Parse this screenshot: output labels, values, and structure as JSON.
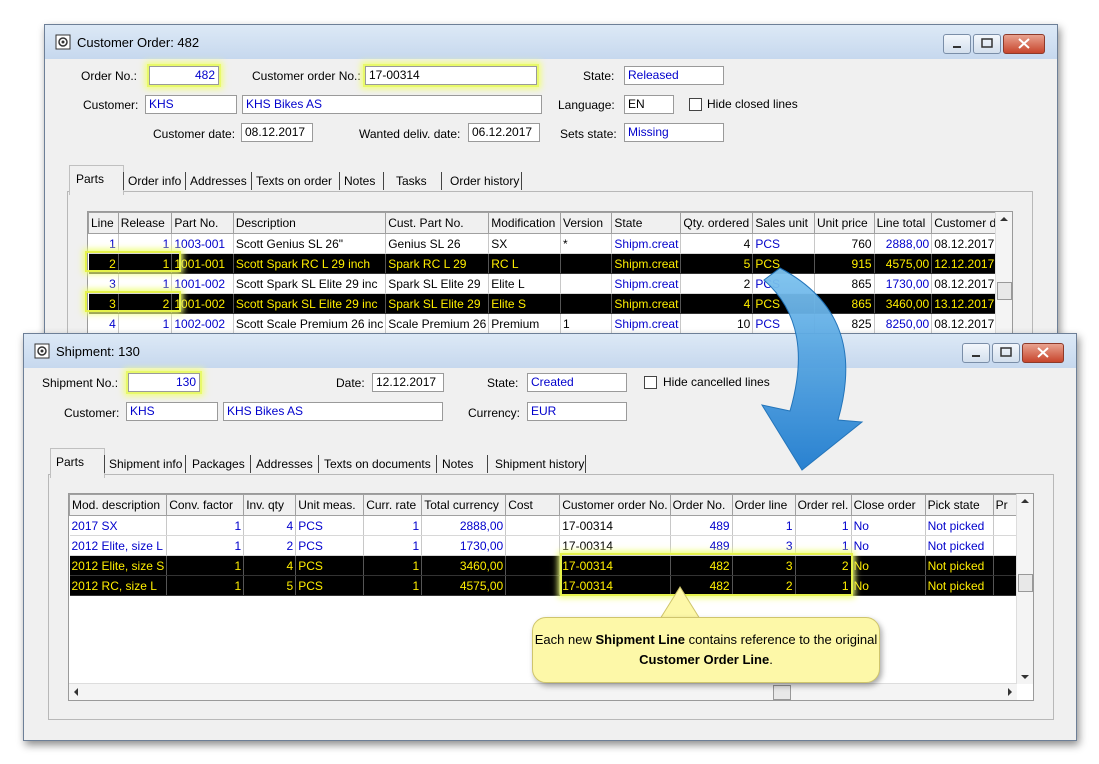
{
  "order_window": {
    "title": "Customer Order: 482",
    "order_no_label": "Order No.:",
    "order_no": "482",
    "customer_order_no_label": "Customer order No.:",
    "customer_order_no": "17-00314",
    "state_label": "State:",
    "state": "Released",
    "customer_label": "Customer:",
    "customer_code": "KHS",
    "customer_name": "KHS Bikes AS",
    "language_label": "Language:",
    "language": "EN",
    "hide_closed_label": "Hide closed lines",
    "customer_date_label": "Customer date:",
    "customer_date": "08.12.2017",
    "wanted_date_label": "Wanted deliv. date:",
    "wanted_date": "06.12.2017",
    "sets_state_label": "Sets state:",
    "sets_state": "Missing",
    "tabs": [
      "Parts",
      "Order info",
      "Addresses",
      "Texts on order",
      "Notes",
      "Tasks",
      "Order history"
    ],
    "columns": [
      "Line",
      "Release",
      "Part No.",
      "Description",
      "Cust. Part No.",
      "Modification",
      "Version",
      "State",
      "Qty. ordered",
      "Sales unit",
      "Unit price",
      "Line total",
      "Customer dat"
    ],
    "rows": [
      {
        "line": "1",
        "release": "1",
        "part": "1003-001",
        "desc": "Scott Genius SL 26\"",
        "cust_part": "Genius SL 26",
        "mod": "SX",
        "version": "*",
        "state": "Shipm.creat",
        "qty": "4",
        "unit": "PCS",
        "price": "760",
        "total": "2888,00",
        "date": "08.12.2017"
      },
      {
        "line": "2",
        "release": "1",
        "part": "1001-001",
        "desc": "Scott Spark RC L 29 inch",
        "cust_part": "Spark RC L 29",
        "mod": "RC L",
        "version": "",
        "state": "Shipm.creat",
        "qty": "5",
        "unit": "PCS",
        "price": "915",
        "total": "4575,00",
        "date": "12.12.2017"
      },
      {
        "line": "3",
        "release": "1",
        "part": "1001-002",
        "desc": "Scott Spark SL Elite 29 inc",
        "cust_part": "Spark SL Elite 29",
        "mod": "Elite L",
        "version": "",
        "state": "Shipm.creat",
        "qty": "2",
        "unit": "PCS",
        "price": "865",
        "total": "1730,00",
        "date": "08.12.2017"
      },
      {
        "line": "3",
        "release": "2",
        "part": "1001-002",
        "desc": "Scott Spark SL Elite 29 inc",
        "cust_part": "Spark SL Elite 29",
        "mod": "Elite S",
        "version": "",
        "state": "Shipm.creat",
        "qty": "4",
        "unit": "PCS",
        "price": "865",
        "total": "3460,00",
        "date": "13.12.2017"
      },
      {
        "line": "4",
        "release": "1",
        "part": "1002-002",
        "desc": "Scott Scale Premium 26 inc",
        "cust_part": "Scale Premium 26",
        "mod": "Premium",
        "version": "1",
        "state": "Shipm.creat",
        "qty": "10",
        "unit": "PCS",
        "price": "825",
        "total": "8250,00",
        "date": "08.12.2017"
      }
    ]
  },
  "shipment_window": {
    "title": "Shipment: 130",
    "shipment_no_label": "Shipment No.:",
    "shipment_no": "130",
    "date_label": "Date:",
    "date": "12.12.2017",
    "state_label": "State:",
    "state": "Created",
    "hide_cancelled_label": "Hide cancelled lines",
    "customer_label": "Customer:",
    "customer_code": "KHS",
    "customer_name": "KHS Bikes AS",
    "currency_label": "Currency:",
    "currency": "EUR",
    "tabs": [
      "Parts",
      "Shipment info",
      "Packages",
      "Addresses",
      "Texts on documents",
      "Notes",
      "Shipment history"
    ],
    "columns": [
      "Mod. description",
      "Conv. factor",
      "Inv. qty",
      "Unit meas.",
      "Curr. rate",
      "Total currency",
      "Cost",
      "Customer order No.",
      "Order No.",
      "Order line",
      "Order rel.",
      "Close order",
      "Pick state",
      "Pr"
    ],
    "rows": [
      {
        "mod": "2017 SX",
        "conv": "1",
        "inv": "4",
        "unit": "PCS",
        "rate": "1",
        "total": "2888,00",
        "cost": "",
        "co_no": "17-00314",
        "order_no": "489",
        "line": "1",
        "rel": "1",
        "close": "No",
        "pick": "Not picked"
      },
      {
        "mod": "2012 Elite, size L",
        "conv": "1",
        "inv": "2",
        "unit": "PCS",
        "rate": "1",
        "total": "1730,00",
        "cost": "",
        "co_no": "17-00314",
        "order_no": "489",
        "line": "3",
        "rel": "1",
        "close": "No",
        "pick": "Not picked"
      },
      {
        "mod": "2012 Elite, size S",
        "conv": "1",
        "inv": "4",
        "unit": "PCS",
        "rate": "1",
        "total": "3460,00",
        "cost": "",
        "co_no": "17-00314",
        "order_no": "482",
        "line": "3",
        "rel": "2",
        "close": "No",
        "pick": "Not picked"
      },
      {
        "mod": "2012 RC, size L",
        "conv": "1",
        "inv": "5",
        "unit": "PCS",
        "rate": "1",
        "total": "4575,00",
        "cost": "",
        "co_no": "17-00314",
        "order_no": "482",
        "line": "2",
        "rel": "1",
        "close": "No",
        "pick": "Not picked"
      }
    ]
  },
  "callout": {
    "part1": "Each new ",
    "bold1": "Shipment Line",
    "part2": " contains reference to the original ",
    "bold2": "Customer Order Line",
    "part3": "."
  },
  "colors": {
    "selected_row_bg": "#000000",
    "selected_row_text": "#ffee00",
    "highlight": "#e8f96a",
    "link_blue": "#0000cc",
    "arrow": "#2a8fd6"
  }
}
